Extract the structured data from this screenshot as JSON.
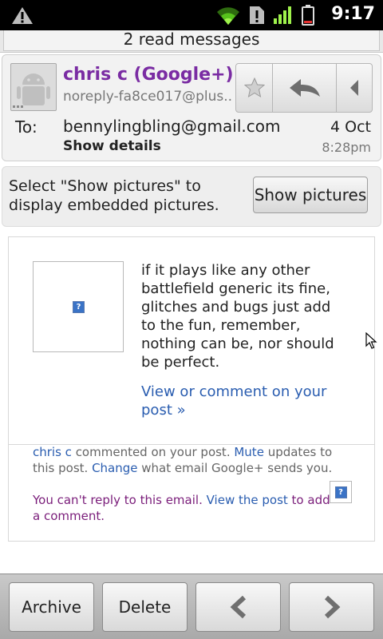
{
  "status_bar": {
    "time": "9:17",
    "icons": [
      "warning-icon",
      "wifi-icon",
      "sim-alert-icon",
      "signal-icon",
      "battery-icon"
    ]
  },
  "read_messages": "2 read messages",
  "header": {
    "sender_name": "chris c (Google+)",
    "sender_email": "noreply-fa8ce017@plus...",
    "to_label": "To:",
    "to_value": "bennylingbling@gmail.com",
    "show_details": "Show details",
    "date": "4 Oct",
    "time": "8:28pm"
  },
  "pictures_bar": {
    "message": "Select \"Show pictures\" to display embedded pictures.",
    "button": "Show pictures"
  },
  "body": {
    "comment_text": "if it plays like any other battlefield generic its fine, glitches and bugs just add to the fun, remember, nothing can be, nor should be perfect.",
    "view_post": "View or comment on your post »",
    "footer": {
      "author": "chris c",
      "commented": " commented on your post. ",
      "mute": "Mute",
      "updates": " updates to this post. ",
      "change": "Change",
      "what_email": " what email Google+ sends you.",
      "cant_reply": "You can't reply to this email. ",
      "view_the_post": "View the post",
      "to_add": " to add a comment."
    },
    "placeholder_glyph": "?"
  },
  "toolbar": {
    "archive": "Archive",
    "delete": "Delete"
  },
  "colors": {
    "sender": "#7a2ca3",
    "link": "#2a5db0",
    "reply_note": "#7a1d7a"
  }
}
